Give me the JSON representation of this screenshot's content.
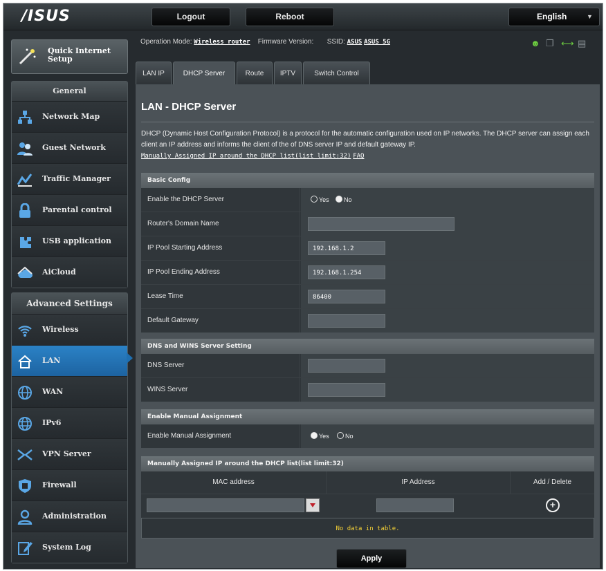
{
  "topbar": {
    "logo": "/ISUS",
    "logout": "Logout",
    "reboot": "Reboot",
    "language": "English"
  },
  "status": {
    "op_mode_label": "Operation Mode:",
    "op_mode_value": "Wireless router",
    "firmware_label": "Firmware Version:",
    "ssid_label": "SSID:",
    "ssid_1": "ASUS",
    "ssid_2": "ASUS_5G",
    "icons": [
      "users-icon",
      "copy-icon",
      "usb-icon",
      "printer-icon"
    ]
  },
  "sidebar": {
    "quick_setup_line1": "Quick Internet",
    "quick_setup_line2": "Setup",
    "general_header": "General",
    "general_items": [
      {
        "label": "Network Map",
        "icon": "network-map-icon"
      },
      {
        "label": "Guest Network",
        "icon": "guest-network-icon"
      },
      {
        "label": "Traffic Manager",
        "icon": "traffic-manager-icon"
      },
      {
        "label": "Parental control",
        "icon": "parental-control-icon"
      },
      {
        "label": "USB application",
        "icon": "usb-application-icon"
      },
      {
        "label": "AiCloud",
        "icon": "aicloud-icon"
      }
    ],
    "advanced_header": "Advanced Settings",
    "advanced_items": [
      {
        "label": "Wireless",
        "icon": "wireless-icon"
      },
      {
        "label": "LAN",
        "icon": "lan-icon",
        "active": true
      },
      {
        "label": "WAN",
        "icon": "wan-icon"
      },
      {
        "label": "IPv6",
        "icon": "ipv6-icon"
      },
      {
        "label": "VPN Server",
        "icon": "vpn-icon"
      },
      {
        "label": "Firewall",
        "icon": "firewall-icon"
      },
      {
        "label": "Administration",
        "icon": "administration-icon"
      },
      {
        "label": "System Log",
        "icon": "system-log-icon"
      }
    ]
  },
  "tabs": [
    "LAN IP",
    "DHCP Server",
    "Route",
    "IPTV",
    "Switch Control"
  ],
  "active_tab": "DHCP Server",
  "main": {
    "title": "LAN - DHCP Server",
    "description": "DHCP (Dynamic Host Configuration Protocol) is a protocol for the automatic configuration used on IP networks. The DHCP server can assign each client an IP address and informs the client of the of DNS server IP and default gateway IP.",
    "link_text": "Manually Assigned IP around the DHCP list(list limit:32)",
    "faq": "FAQ",
    "basic": {
      "header": "Basic Config",
      "enable_label": "Enable the DHCP Server",
      "yes": "Yes",
      "no": "No",
      "enable_value": "No",
      "domain_label": "Router's Domain Name",
      "domain_value": "",
      "pool_start_label": "IP Pool Starting Address",
      "pool_start_value": "192.168.1.2",
      "pool_end_label": "IP Pool Ending Address",
      "pool_end_value": "192.168.1.254",
      "lease_label": "Lease Time",
      "lease_value": "86400",
      "gateway_label": "Default Gateway",
      "gateway_value": ""
    },
    "dns": {
      "header": "DNS and WINS Server Setting",
      "dns_label": "DNS Server",
      "dns_value": "",
      "wins_label": "WINS Server",
      "wins_value": ""
    },
    "manual": {
      "header": "Enable Manual Assignment",
      "label": "Enable Manual Assignment",
      "yes": "Yes",
      "no": "No",
      "value": "Yes"
    },
    "list": {
      "header": "Manually Assigned IP around the DHCP list(list limit:32)",
      "col_mac": "MAC address",
      "col_ip": "IP Address",
      "col_action": "Add / Delete",
      "empty": "No data in table."
    },
    "apply": "Apply"
  },
  "colors": {
    "background": "#262b2f",
    "panel": "#4b5257",
    "active": "#1f6fb0",
    "empty_text": "#f3d037"
  }
}
